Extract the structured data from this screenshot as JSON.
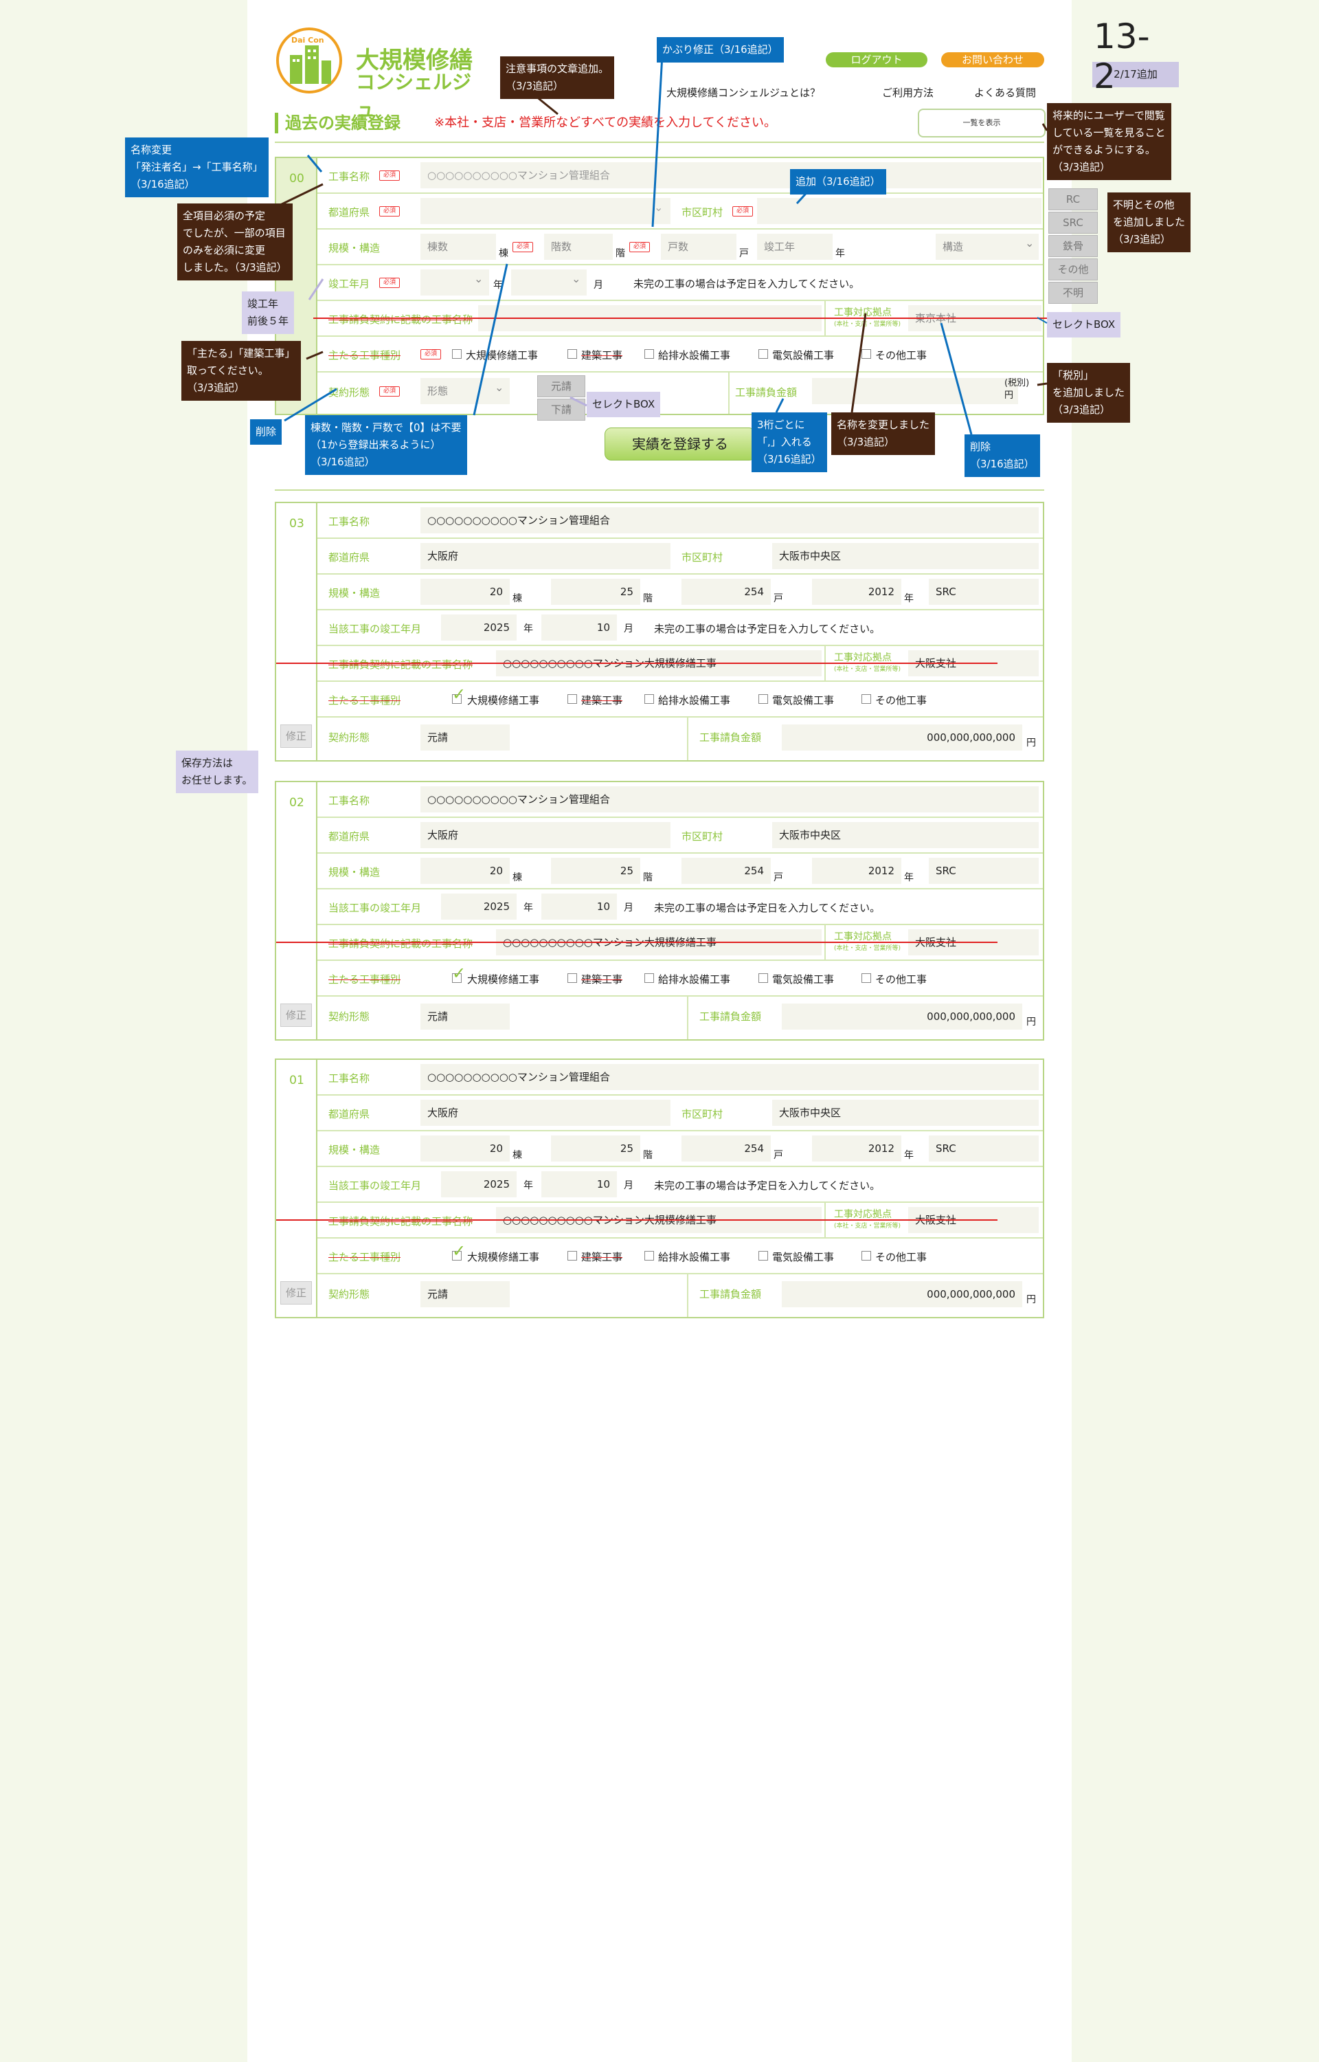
{
  "header": {
    "logo_small": "Dai Con",
    "logo_line1": "大規模修繕",
    "logo_line2": "コンシェルジュ",
    "logout": "ログアウト",
    "contact": "お問い合わせ",
    "nav": [
      "大規模修繕コンシェルジュとは？",
      "ご利用方法",
      "よくある質問"
    ],
    "page_no": "13-2",
    "page_badge": "2/17追加"
  },
  "section": {
    "title": "過去の実績登録",
    "notice": "※本社・支店・営業所などすべての実績を入力してください。",
    "list_button": "一覧を表示"
  },
  "colors": {
    "accent": "#8cc43c",
    "orange": "#f0a020",
    "annotation_blue": "#0b6fbd",
    "annotation_brown": "#472411",
    "annotation_lavender": "#d6d1ec",
    "red": "#e02020"
  },
  "form": {
    "number": "00",
    "required": "必須",
    "work_name_label": "工事名称",
    "work_name_placeholder": "○○○○○○○○○○マンション管理組合",
    "pref_label": "都道府県",
    "city_label": "市区町村",
    "scale_label": "規模・構造",
    "buildings_ph": "棟数",
    "buildings_unit": "棟",
    "floors_ph": "階数",
    "floors_unit": "階",
    "units_ph": "戸数",
    "units_unit": "戸",
    "built_ph": "竣工年",
    "built_unit": "年",
    "structure_ph": "構造",
    "completion_label": "竣工年月",
    "year_unit": "年",
    "month_unit": "月",
    "completion_note": "未完の工事の場合は予定日を入力してください。",
    "contract_name_label": "工事請負契約に記載の工事名称",
    "office_label": "工事対応拠点",
    "office_sub": "(本社・支店・営業所等)",
    "office_value": "東京本社",
    "types_label": "主たる工事種別",
    "types": [
      "大規模修繕工事",
      "建築工事",
      "給排水設備工事",
      "電気設備工事",
      "その他工事"
    ],
    "contract_type_label": "契約形態",
    "contract_type_ph": "形態",
    "contract_options": [
      "元請",
      "下請"
    ],
    "amount_label": "工事請負金額",
    "tax_note": "(税別)",
    "yen": "円",
    "structure_options": [
      "RC",
      "SRC",
      "鉄骨",
      "その他",
      "不明"
    ],
    "submit": "実績を登録する"
  },
  "records": [
    {
      "number": "03",
      "work_name": "○○○○○○○○○○マンション管理組合",
      "pref": "大阪府",
      "city": "大阪市中央区",
      "buildings": "20",
      "floors": "25",
      "units": "254",
      "built": "2012",
      "structure": "SRC",
      "completion_label": "当該工事の竣工年月",
      "comp_year": "2025",
      "comp_month": "10",
      "contract_name": "○○○○○○○○○○マンション大規模修繕工事",
      "office": "大阪支社",
      "contract_type": "元請",
      "amount": "000,000,000,000",
      "fix": "修正"
    },
    {
      "number": "02",
      "work_name": "○○○○○○○○○○マンション管理組合",
      "pref": "大阪府",
      "city": "大阪市中央区",
      "buildings": "20",
      "floors": "25",
      "units": "254",
      "built": "2012",
      "structure": "SRC",
      "completion_label": "当該工事の竣工年月",
      "comp_year": "2025",
      "comp_month": "10",
      "contract_name": "○○○○○○○○○○マンション大規模修繕工事",
      "office": "大阪支社",
      "contract_type": "元請",
      "amount": "000,000,000,000",
      "fix": "修正"
    },
    {
      "number": "01",
      "work_name": "○○○○○○○○○○マンション管理組合",
      "pref": "大阪府",
      "city": "大阪市中央区",
      "buildings": "20",
      "floors": "25",
      "units": "254",
      "built": "2012",
      "structure": "SRC",
      "completion_label": "当該工事の竣工年月",
      "comp_year": "2025",
      "comp_month": "10",
      "contract_name": "○○○○○○○○○○マンション大規模修繕工事",
      "office": "大阪支社",
      "contract_type": "元請",
      "amount": "000,000,000,000",
      "fix": "修正"
    }
  ],
  "annotations": {
    "a_notice": "注意事項の文章追加。\n（3/3追記）",
    "a_overlap": "かぶり修正（3/16追記）",
    "a_future": "将来的にユーザーで閲覧\nしている一覧を見ること\nができるようにする。\n（3/3追記）",
    "a_rename": "名称変更\n「発注者名」→「工事名称」\n（3/16追記）",
    "a_added": "追加（3/16追記）",
    "a_required": "全項目必須の予定\nでしたが、一部の項目\nのみを必須に変更\nしました。（3/3追記）",
    "a_unknown": "不明とその他\nを追加しました\n（3/3追記）",
    "a_built": "竣工年\n前後５年",
    "a_select1": "セレクトBOX",
    "a_remove_main": "「主たる」「建築工事」\n取ってください。\n（3/3追記）",
    "a_tax": "「税別」\nを追加しました\n（3/3追記）",
    "a_select2": "セレクトBOX",
    "a_delete1": "削除",
    "a_zero": "棟数・階数・戸数で【0】は不要\n（1から登録出来るように）\n（3/16追記）",
    "a_comma": "3桁ごとに\n「,」入れる\n（3/16追記）",
    "a_renamed": "名称を変更しました\n（3/3追記）",
    "a_delete2": "削除\n（3/16追記）",
    "a_save": "保存方法は\nお任せします。"
  }
}
